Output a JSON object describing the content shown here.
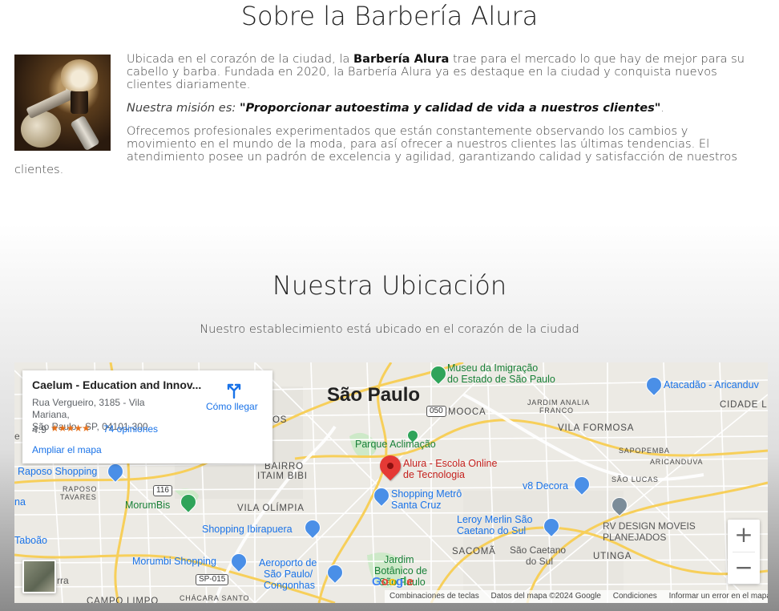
{
  "about": {
    "title": "Sobre la Barbería Alura",
    "p1_before": "Ubicada en el corazón de la ciudad, la ",
    "p1_brand": "Barbería Alura",
    "p1_after": " trae para el mercado lo que hay de mejor para su cabello y barba. Fundada en 2020, la Barbería Alura ya es destaque en la ciudad y conquista nuevos clientes diariamente.",
    "mission_label": "Nuestra misión es: ",
    "mission_text": "\"Proporcionar autoestima y calidad de vida a nuestros clientes\"",
    "mission_end": ".",
    "p3": "Ofrecemos profesionales experimentados que están constantemente observando los cambios y movimiento en el mundo de la moda, para así ofrecer a nuestros clientes las últimas tendencias. El atendimiento posee un padrón de excelencia y agilidad, garantizando calidad y satisfacción de nuestros clientes."
  },
  "location": {
    "title": "Nuestra Ubicación",
    "subtitle": "Nuestro establecimiento está ubicado en el corazón de la ciudad"
  },
  "map": {
    "card": {
      "name": "Caelum - Education and Innov...",
      "address_line1": "Rua Vergueiro, 3185 - Vila Mariana,",
      "address_line2": "São Paulo - SP, 04101-300",
      "rating": "4.9",
      "stars": "★★★★★",
      "reviews": "74 opiniones",
      "enlarge": "Ampliar el mapa",
      "directions": "Cómo llegar"
    },
    "labels": {
      "city": "São Paulo",
      "museu": "Museu da Imigração",
      "museu2": "do Estado de São Paulo",
      "atacadao": "Atacadão - Aricanduv",
      "jardim_analia": "JARDIM ANALIA",
      "franco": "FRANCO",
      "cidade_l": "CIDADE L",
      "mooca": "MOOCA",
      "vila_formosa": "VILA FORMOSA",
      "sapopemba": "SAPOPEMBA",
      "aricanduva": "ARICANDUVA",
      "parque": "Parque Aclimação",
      "alura": "Alura - Escola Online",
      "alura2": "de Tecnologia",
      "shopping_metro": "Shopping Metrô",
      "shopping_metro2": "Santa Cruz",
      "v8": "v8 Decora",
      "sao_lucas": "SÃO LUCAS",
      "rv": "RV DESIGN MOVEIS",
      "rv2": "PLANEJADOS",
      "leroy": "Leroy Merlin São",
      "leroy2": "Caetano do Sul",
      "sacoma": "SACOMÃ",
      "sao_caetano": "São Caetano",
      "sao_caetano2": "do Sul",
      "utinga": "UTINGA",
      "raposo": "Raposo Shopping",
      "raposo_tavares": "RAPOSO",
      "raposo_tavares2": "TAVARES",
      "bairro": "BAIRRO",
      "itaim": "ITAIM BIBI",
      "morumbis": "MorumBis",
      "vila_olimpia": "VILA OLÍMPIA",
      "shopping_ibira": "Shopping Ibirapuera",
      "taboao": "Taboão",
      "morumbi": "Morumbi Shopping",
      "aeroporto": "Aeroporto de",
      "aeroporto2": "São Paulo/",
      "aeroporto3": "Congonhas",
      "jardim_botanico": "Jardim",
      "jardim_botanico2": "Botânico de",
      "jardim_botanico3": "São Paulo",
      "campo_limpo": "CAMPO LIMPO",
      "chacara": "CHÁCARA SANTO",
      "rra": "rra",
      "os": "OS",
      "e": "e",
      "na": "na",
      "shield_050": "050",
      "shield_116": "116",
      "shield_sp015": "SP-015"
    },
    "google": "Google",
    "attribution": {
      "shortcuts": "Combinaciones de teclas",
      "data": "Datos del mapa ©2024 Google",
      "terms": "Condiciones",
      "report": "Informar un error en el mapa"
    },
    "zoom_in": "+",
    "zoom_out": "−"
  }
}
